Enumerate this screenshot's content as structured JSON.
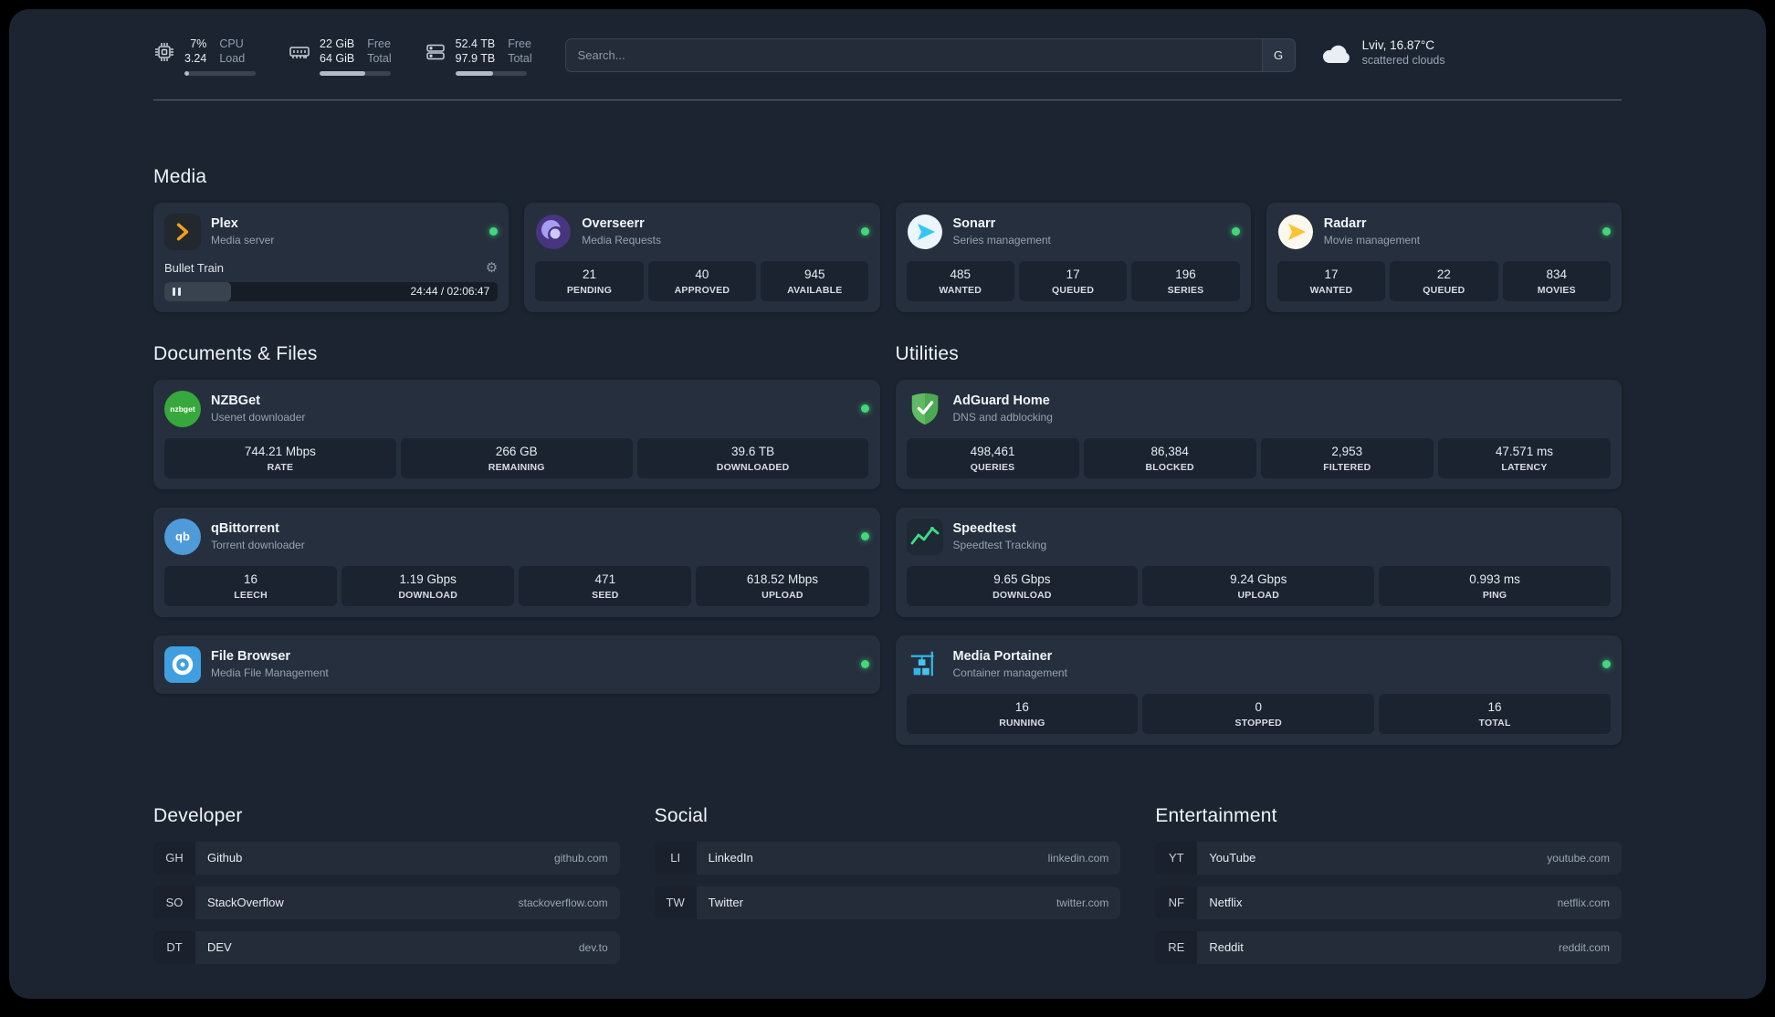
{
  "colors": {
    "status_online": "#41d77d",
    "plex_accent": "#f0a01e",
    "background": "#1c2431",
    "card": "#262f3d"
  },
  "topbar": {
    "cpu": {
      "value_top": "7%",
      "value_bottom": "3.24",
      "label_top": "CPU",
      "label_bottom": "Load",
      "bar_percent": 7
    },
    "memory": {
      "value_top": "22 GiB",
      "value_bottom": "64 GiB",
      "label_top": "Free",
      "label_bottom": "Total",
      "bar_percent": 64
    },
    "storage": {
      "value_top": "52.4 TB",
      "value_bottom": "97.9 TB",
      "label_top": "Free",
      "label_bottom": "Total",
      "bar_percent": 53
    },
    "search": {
      "placeholder": "Search...",
      "provider": "G"
    },
    "weather": {
      "location": "Lviv, 16.87°C",
      "condition": "scattered clouds"
    }
  },
  "sections": {
    "media": "Media",
    "documents": "Documents & Files",
    "utilities": "Utilities",
    "developer": "Developer",
    "social": "Social",
    "entertainment": "Entertainment"
  },
  "services": {
    "plex": {
      "name": "Plex",
      "subtitle": "Media server",
      "now_playing": "Bullet Train",
      "time": "24:44 / 02:06:47",
      "progress_percent": 20
    },
    "overseerr": {
      "name": "Overseerr",
      "subtitle": "Media Requests",
      "stats": [
        {
          "value": "21",
          "label": "PENDING"
        },
        {
          "value": "40",
          "label": "APPROVED"
        },
        {
          "value": "945",
          "label": "AVAILABLE"
        }
      ]
    },
    "sonarr": {
      "name": "Sonarr",
      "subtitle": "Series management",
      "stats": [
        {
          "value": "485",
          "label": "WANTED"
        },
        {
          "value": "17",
          "label": "QUEUED"
        },
        {
          "value": "196",
          "label": "SERIES"
        }
      ]
    },
    "radarr": {
      "name": "Radarr",
      "subtitle": "Movie management",
      "stats": [
        {
          "value": "17",
          "label": "WANTED"
        },
        {
          "value": "22",
          "label": "QUEUED"
        },
        {
          "value": "834",
          "label": "MOVIES"
        }
      ]
    },
    "nzbget": {
      "name": "NZBGet",
      "subtitle": "Usenet downloader",
      "icon_text": "nzbget",
      "stats": [
        {
          "value": "744.21 Mbps",
          "label": "RATE"
        },
        {
          "value": "266 GB",
          "label": "REMAINING"
        },
        {
          "value": "39.6 TB",
          "label": "DOWNLOADED"
        }
      ]
    },
    "qbittorrent": {
      "name": "qBittorrent",
      "subtitle": "Torrent downloader",
      "icon_text": "qb",
      "stats": [
        {
          "value": "16",
          "label": "LEECH"
        },
        {
          "value": "1.19 Gbps",
          "label": "DOWNLOAD"
        },
        {
          "value": "471",
          "label": "SEED"
        },
        {
          "value": "618.52 Mbps",
          "label": "UPLOAD"
        }
      ]
    },
    "filebrowser": {
      "name": "File Browser",
      "subtitle": "Media File Management"
    },
    "adguard": {
      "name": "AdGuard Home",
      "subtitle": "DNS and adblocking",
      "stats": [
        {
          "value": "498,461",
          "label": "QUERIES"
        },
        {
          "value": "86,384",
          "label": "BLOCKED"
        },
        {
          "value": "2,953",
          "label": "FILTERED"
        },
        {
          "value": "47.571 ms",
          "label": "LATENCY"
        }
      ]
    },
    "speedtest": {
      "name": "Speedtest",
      "subtitle": "Speedtest Tracking",
      "stats": [
        {
          "value": "9.65 Gbps",
          "label": "DOWNLOAD"
        },
        {
          "value": "9.24 Gbps",
          "label": "UPLOAD"
        },
        {
          "value": "0.993 ms",
          "label": "PING"
        }
      ]
    },
    "portainer": {
      "name": "Media Portainer",
      "subtitle": "Container management",
      "stats": [
        {
          "value": "16",
          "label": "RUNNING"
        },
        {
          "value": "0",
          "label": "STOPPED"
        },
        {
          "value": "16",
          "label": "TOTAL"
        }
      ]
    }
  },
  "bookmarks": {
    "developer": [
      {
        "abbr": "GH",
        "name": "Github",
        "domain": "github.com"
      },
      {
        "abbr": "SO",
        "name": "StackOverflow",
        "domain": "stackoverflow.com"
      },
      {
        "abbr": "DT",
        "name": "DEV",
        "domain": "dev.to"
      }
    ],
    "social": [
      {
        "abbr": "LI",
        "name": "LinkedIn",
        "domain": "linkedin.com"
      },
      {
        "abbr": "TW",
        "name": "Twitter",
        "domain": "twitter.com"
      }
    ],
    "entertainment": [
      {
        "abbr": "YT",
        "name": "YouTube",
        "domain": "youtube.com"
      },
      {
        "abbr": "NF",
        "name": "Netflix",
        "domain": "netflix.com"
      },
      {
        "abbr": "RE",
        "name": "Reddit",
        "domain": "reddit.com"
      }
    ]
  }
}
